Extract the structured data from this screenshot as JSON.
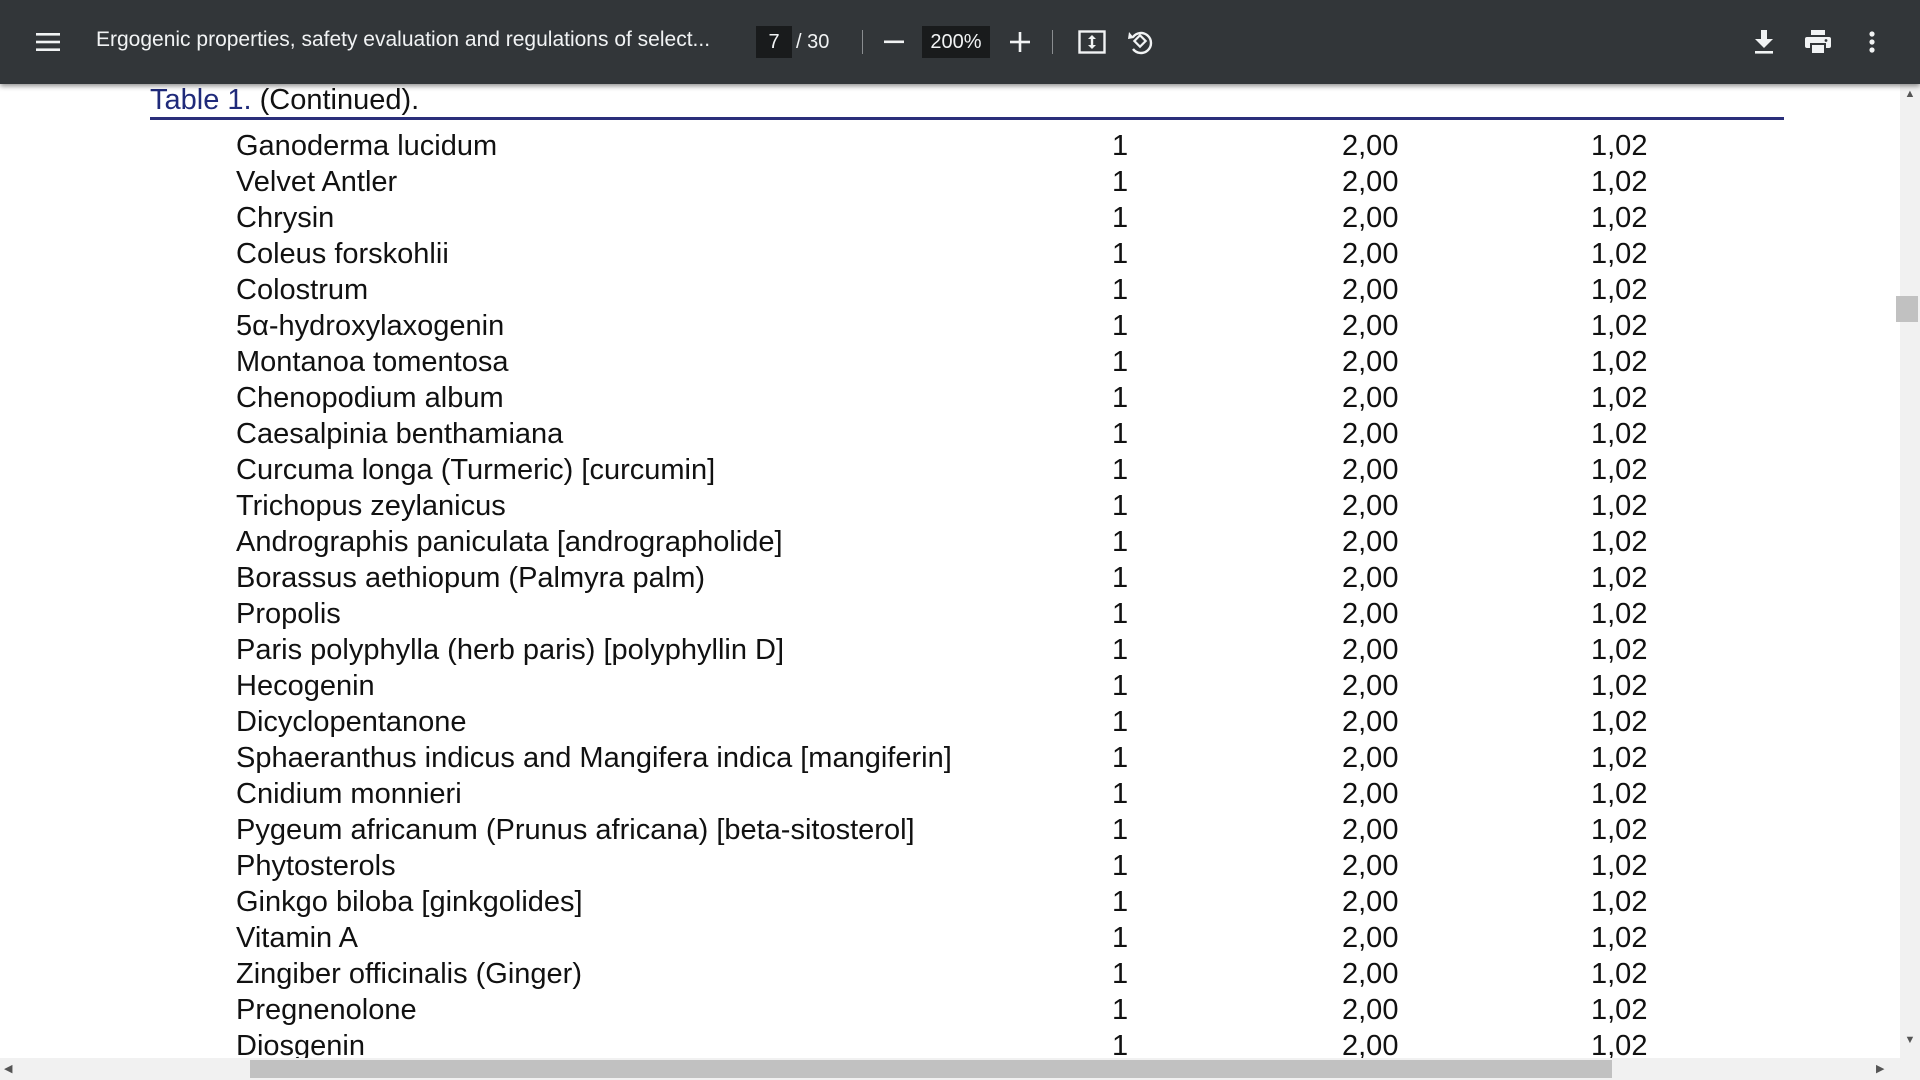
{
  "toolbar": {
    "title": "Ergogenic properties, safety evaluation and regulations of select...",
    "current_page": "7",
    "total_pages": "/ 30",
    "zoom": "200%",
    "icons": [
      "menu-icon",
      "zoom-out-icon",
      "zoom-in-icon",
      "fit-page-icon",
      "rotate-icon",
      "download-icon",
      "print-icon",
      "more-vert-icon"
    ]
  },
  "document": {
    "caption_label": "Table 1.",
    "caption_rest": " (Continued).",
    "rows": [
      {
        "name": "Ganoderma lucidum",
        "n": "1",
        "p": "2,00",
        "w": "1,02"
      },
      {
        "name": "Velvet Antler",
        "n": "1",
        "p": "2,00",
        "w": "1,02"
      },
      {
        "name": "Chrysin",
        "n": "1",
        "p": "2,00",
        "w": "1,02"
      },
      {
        "name": "Coleus forskohlii",
        "n": "1",
        "p": "2,00",
        "w": "1,02"
      },
      {
        "name": "Colostrum",
        "n": "1",
        "p": "2,00",
        "w": "1,02"
      },
      {
        "name": "5α-hydroxylaxogenin",
        "n": "1",
        "p": "2,00",
        "w": "1,02"
      },
      {
        "name": "Montanoa tomentosa",
        "n": "1",
        "p": "2,00",
        "w": "1,02"
      },
      {
        "name": "Chenopodium album",
        "n": "1",
        "p": "2,00",
        "w": "1,02"
      },
      {
        "name": "Caesalpinia benthamiana",
        "n": "1",
        "p": "2,00",
        "w": "1,02"
      },
      {
        "name": "Curcuma longa (Turmeric) [curcumin]",
        "n": "1",
        "p": "2,00",
        "w": "1,02"
      },
      {
        "name": "Trichopus zeylanicus",
        "n": "1",
        "p": "2,00",
        "w": "1,02"
      },
      {
        "name": "Andrographis paniculata [andrographolide]",
        "n": "1",
        "p": "2,00",
        "w": "1,02"
      },
      {
        "name": "Borassus aethiopum (Palmyra palm)",
        "n": "1",
        "p": "2,00",
        "w": "1,02"
      },
      {
        "name": "Propolis",
        "n": "1",
        "p": "2,00",
        "w": "1,02"
      },
      {
        "name": "Paris polyphylla (herb paris) [polyphyllin D]",
        "n": "1",
        "p": "2,00",
        "w": "1,02"
      },
      {
        "name": "Hecogenin",
        "n": "1",
        "p": "2,00",
        "w": "1,02"
      },
      {
        "name": "Dicyclopentanone",
        "n": "1",
        "p": "2,00",
        "w": "1,02"
      },
      {
        "name": "Sphaeranthus indicus and Mangifera indica [mangiferin]",
        "n": "1",
        "p": "2,00",
        "w": "1,02"
      },
      {
        "name": "Cnidium monnieri",
        "n": "1",
        "p": "2,00",
        "w": "1,02"
      },
      {
        "name": "Pygeum africanum (Prunus africana) [beta-sitosterol]",
        "n": "1",
        "p": "2,00",
        "w": "1,02"
      },
      {
        "name": "Phytosterols",
        "n": "1",
        "p": "2,00",
        "w": "1,02"
      },
      {
        "name": "Ginkgo biloba [ginkgolides]",
        "n": "1",
        "p": "2,00",
        "w": "1,02"
      },
      {
        "name": "Vitamin A",
        "n": "1",
        "p": "2,00",
        "w": "1,02"
      },
      {
        "name": "Zingiber officinalis (Ginger)",
        "n": "1",
        "p": "2,00",
        "w": "1,02"
      },
      {
        "name": "Pregnenolone",
        "n": "1",
        "p": "2,00",
        "w": "1,02"
      },
      {
        "name": "Diosgenin",
        "n": "1",
        "p": "2,00",
        "w": "1,02"
      }
    ]
  },
  "colors": {
    "toolbar_bg": "#323639",
    "caption_blue": "#1f2a7a",
    "rule_color": "#2a2f7a"
  }
}
